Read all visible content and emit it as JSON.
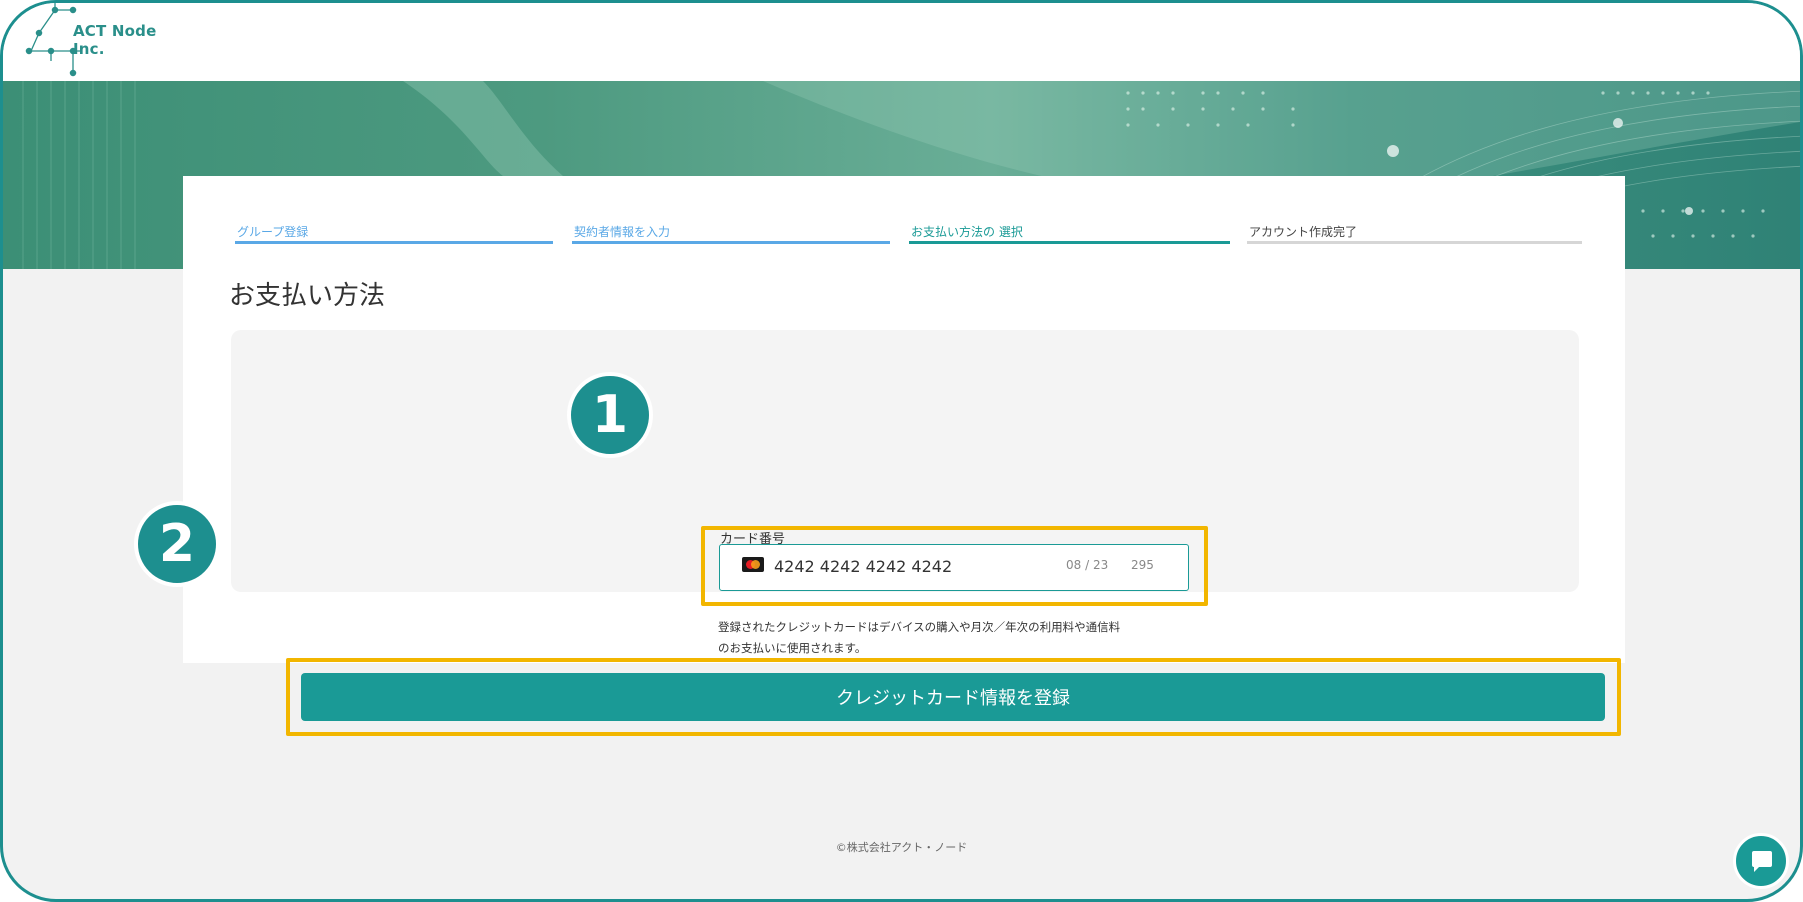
{
  "brand": {
    "name": "ACT Node Inc."
  },
  "steps": [
    {
      "label": "グループ登録",
      "state": "done"
    },
    {
      "label": "契約者情報を入力",
      "state": "done"
    },
    {
      "label": "お支払い方法の 選択",
      "state": "current"
    },
    {
      "label": "アカウント作成完了",
      "state": "todo"
    }
  ],
  "page": {
    "title": "お支払い方法"
  },
  "payment": {
    "card_label": "カード番号",
    "card_number": "4242 4242 4242 4242",
    "expiry": "08 / 23",
    "cvc": "295",
    "brand_icon": "mastercard-icon",
    "notice_line1": "登録されたクレジットカードはデバイスの購入や月次／年次の利用料や通信料",
    "notice_line2": "のお支払いに使用されます。",
    "submit_label": "クレジットカード情報を登録"
  },
  "annotations": {
    "badge1": "1",
    "badge2": "2"
  },
  "footer": {
    "copyright": "©株式会社アクト・ノード"
  },
  "colors": {
    "accent": "#1a9a96",
    "highlight": "#f2b600",
    "step_done": "#5aa8e6",
    "step_current": "#1a9a96",
    "step_todo": "#d6d6d6"
  }
}
